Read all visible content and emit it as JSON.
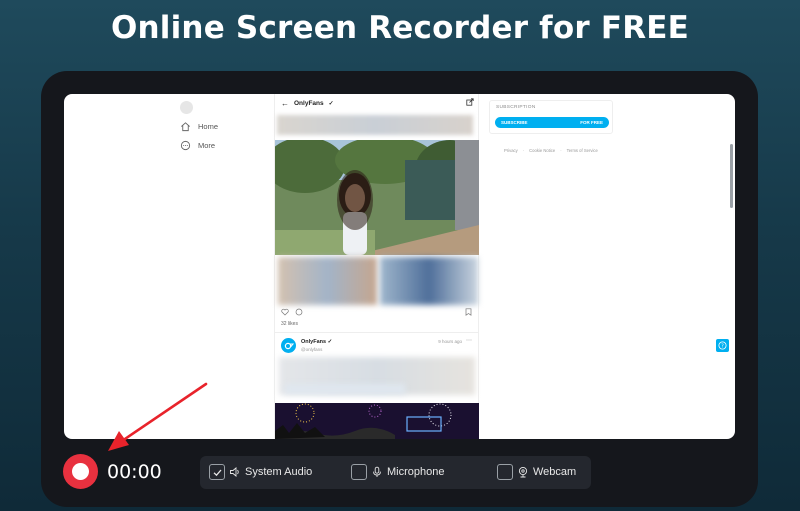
{
  "banner": {
    "title": "Online Screen Recorder for FREE"
  },
  "colors": {
    "accent": "#00aff0",
    "record": "#e8313f",
    "arrow": "#e8232b"
  },
  "captured_page": {
    "nav": [
      {
        "label": "Home",
        "icon": "home-icon"
      },
      {
        "label": "More",
        "icon": "more-circle-icon"
      }
    ],
    "feed_header": {
      "title": "OnlyFans"
    },
    "post1": {
      "likes": "32 likes"
    },
    "post2": {
      "name": "OnlyFans",
      "handle": "@onlyfans",
      "time": "9 hours ago"
    },
    "subscription": {
      "label": "SUBSCRIPTION",
      "button_left": "SUBSCRIBE",
      "button_right": "FOR FREE"
    },
    "footer_links": [
      "Privacy",
      "Cookie Notice",
      "Terms of Service"
    ]
  },
  "recorder": {
    "timer": "00:00",
    "options": [
      {
        "label": "System Audio",
        "checked": true,
        "icon": "speaker-icon"
      },
      {
        "label": "Microphone",
        "checked": false,
        "icon": "microphone-icon"
      },
      {
        "label": "Webcam",
        "checked": false,
        "icon": "webcam-icon"
      }
    ]
  }
}
